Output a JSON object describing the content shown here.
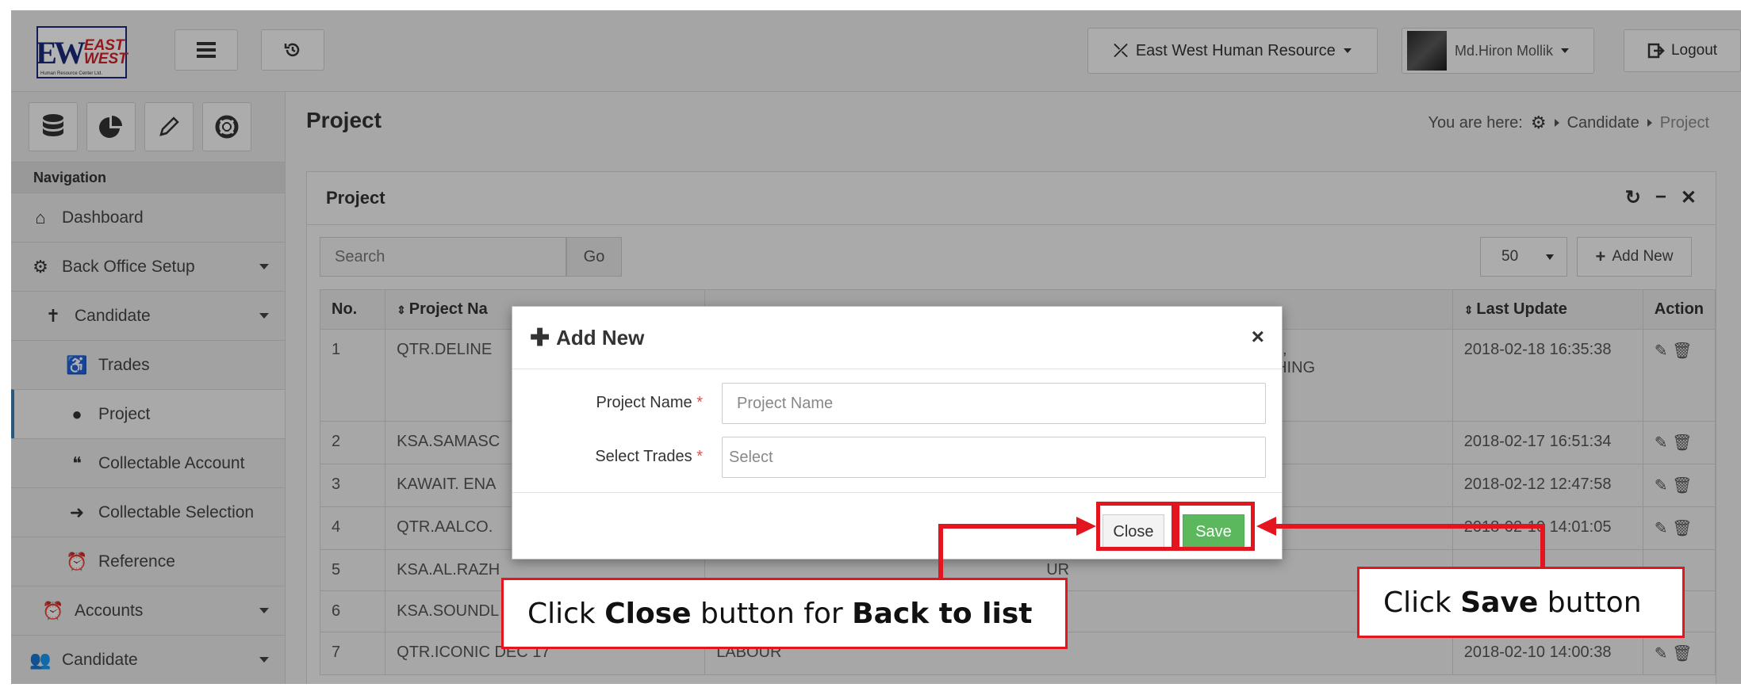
{
  "topbar": {
    "logo": {
      "mark": "EW",
      "line1": "EAST",
      "line2": "WEST",
      "subtitle": "Human Resource Center Ltd."
    },
    "org_label": "East West Human Resource",
    "user_label": "Md.Hiron Mollik",
    "logout_label": "Logout"
  },
  "sidebar": {
    "nav_heading": "Navigation",
    "items": [
      {
        "label": "Dashboard",
        "icon": "home-icon"
      },
      {
        "label": "Back Office Setup",
        "icon": "gears-icon"
      },
      {
        "label": "Candidate",
        "icon": "person-icon"
      },
      {
        "label": "Trades",
        "icon": "wheelchair-icon"
      },
      {
        "label": "Project",
        "icon": "apple-icon"
      },
      {
        "label": "Collectable Account",
        "icon": "comment-icon"
      },
      {
        "label": "Collectable Selection",
        "icon": "sign-in-icon"
      },
      {
        "label": "Reference",
        "icon": "clock-icon"
      },
      {
        "label": "Accounts",
        "icon": "clock-icon"
      },
      {
        "label": "Candidate",
        "icon": "users-icon"
      }
    ]
  },
  "page": {
    "title": "Project",
    "breadcrumb_prefix": "You are here:",
    "breadcrumb": [
      "Candidate",
      "Project"
    ]
  },
  "panel": {
    "title": "Project",
    "search_placeholder": "Search",
    "go_label": "Go",
    "page_size": "50",
    "add_new_label": "Add New",
    "columns": [
      "No.",
      "Project Na",
      "",
      "Last Update",
      "Action"
    ],
    "rows": [
      {
        "no": "1",
        "name": "QTR.DELINE",
        "trades": "ER,\nISHING",
        "updated": "2018-02-18 16:35:38"
      },
      {
        "no": "2",
        "name": "KSA.SAMASC",
        "trades": "",
        "updated": "2018-02-17 16:51:34"
      },
      {
        "no": "3",
        "name": "KAWAIT. ENA",
        "trades": "",
        "updated": "2018-02-12 12:47:58"
      },
      {
        "no": "4",
        "name": "QTR.AALCO.",
        "trades": "",
        "updated": "2018-02-10 14:01:05"
      },
      {
        "no": "5",
        "name": "KSA.AL.RAZH",
        "trades": "UR",
        "updated": ""
      },
      {
        "no": "6",
        "name": "KSA.SOUNDL",
        "trades": "",
        "updated": ""
      },
      {
        "no": "7",
        "name": "QTR.ICONIC DEC 17",
        "trades": "LABOUR",
        "updated": "2018-02-10 14:00:38"
      }
    ]
  },
  "modal": {
    "title": "Add New",
    "fields": [
      {
        "label": "Project Name",
        "placeholder": "Project Name"
      },
      {
        "label": "Select Trades",
        "placeholder": "Select"
      }
    ],
    "close_label": "Close",
    "save_label": "Save"
  },
  "annotations": {
    "close_callout": {
      "pre": "Click ",
      "b1": "Close",
      "mid": " button for ",
      "b2": "Back to list"
    },
    "save_callout": {
      "pre": "Click ",
      "b1": "Save",
      "post": " button"
    },
    "color": "#e3161f"
  }
}
